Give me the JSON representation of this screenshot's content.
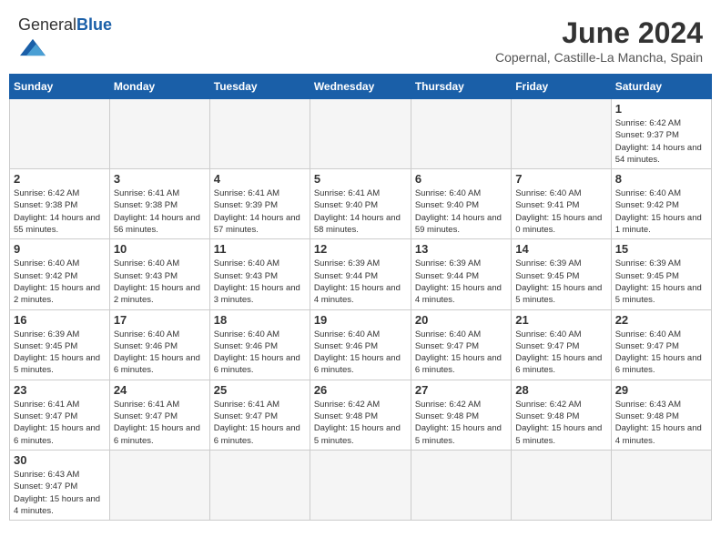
{
  "header": {
    "logo_general": "General",
    "logo_blue": "Blue",
    "month_title": "June 2024",
    "location": "Copernal, Castille-La Mancha, Spain"
  },
  "days_of_week": [
    "Sunday",
    "Monday",
    "Tuesday",
    "Wednesday",
    "Thursday",
    "Friday",
    "Saturday"
  ],
  "weeks": [
    [
      {
        "num": "",
        "info": "",
        "empty": true
      },
      {
        "num": "",
        "info": "",
        "empty": true
      },
      {
        "num": "",
        "info": "",
        "empty": true
      },
      {
        "num": "",
        "info": "",
        "empty": true
      },
      {
        "num": "",
        "info": "",
        "empty": true
      },
      {
        "num": "",
        "info": "",
        "empty": true
      },
      {
        "num": "1",
        "info": "Sunrise: 6:42 AM\nSunset: 9:37 PM\nDaylight: 14 hours\nand 54 minutes.",
        "empty": false
      }
    ],
    [
      {
        "num": "2",
        "info": "Sunrise: 6:42 AM\nSunset: 9:38 PM\nDaylight: 14 hours\nand 55 minutes.",
        "empty": false
      },
      {
        "num": "3",
        "info": "Sunrise: 6:41 AM\nSunset: 9:38 PM\nDaylight: 14 hours\nand 56 minutes.",
        "empty": false
      },
      {
        "num": "4",
        "info": "Sunrise: 6:41 AM\nSunset: 9:39 PM\nDaylight: 14 hours\nand 57 minutes.",
        "empty": false
      },
      {
        "num": "5",
        "info": "Sunrise: 6:41 AM\nSunset: 9:40 PM\nDaylight: 14 hours\nand 58 minutes.",
        "empty": false
      },
      {
        "num": "6",
        "info": "Sunrise: 6:40 AM\nSunset: 9:40 PM\nDaylight: 14 hours\nand 59 minutes.",
        "empty": false
      },
      {
        "num": "7",
        "info": "Sunrise: 6:40 AM\nSunset: 9:41 PM\nDaylight: 15 hours\nand 0 minutes.",
        "empty": false
      },
      {
        "num": "8",
        "info": "Sunrise: 6:40 AM\nSunset: 9:42 PM\nDaylight: 15 hours\nand 1 minute.",
        "empty": false
      }
    ],
    [
      {
        "num": "9",
        "info": "Sunrise: 6:40 AM\nSunset: 9:42 PM\nDaylight: 15 hours\nand 2 minutes.",
        "empty": false
      },
      {
        "num": "10",
        "info": "Sunrise: 6:40 AM\nSunset: 9:43 PM\nDaylight: 15 hours\nand 2 minutes.",
        "empty": false
      },
      {
        "num": "11",
        "info": "Sunrise: 6:40 AM\nSunset: 9:43 PM\nDaylight: 15 hours\nand 3 minutes.",
        "empty": false
      },
      {
        "num": "12",
        "info": "Sunrise: 6:39 AM\nSunset: 9:44 PM\nDaylight: 15 hours\nand 4 minutes.",
        "empty": false
      },
      {
        "num": "13",
        "info": "Sunrise: 6:39 AM\nSunset: 9:44 PM\nDaylight: 15 hours\nand 4 minutes.",
        "empty": false
      },
      {
        "num": "14",
        "info": "Sunrise: 6:39 AM\nSunset: 9:45 PM\nDaylight: 15 hours\nand 5 minutes.",
        "empty": false
      },
      {
        "num": "15",
        "info": "Sunrise: 6:39 AM\nSunset: 9:45 PM\nDaylight: 15 hours\nand 5 minutes.",
        "empty": false
      }
    ],
    [
      {
        "num": "16",
        "info": "Sunrise: 6:39 AM\nSunset: 9:45 PM\nDaylight: 15 hours\nand 5 minutes.",
        "empty": false
      },
      {
        "num": "17",
        "info": "Sunrise: 6:40 AM\nSunset: 9:46 PM\nDaylight: 15 hours\nand 6 minutes.",
        "empty": false
      },
      {
        "num": "18",
        "info": "Sunrise: 6:40 AM\nSunset: 9:46 PM\nDaylight: 15 hours\nand 6 minutes.",
        "empty": false
      },
      {
        "num": "19",
        "info": "Sunrise: 6:40 AM\nSunset: 9:46 PM\nDaylight: 15 hours\nand 6 minutes.",
        "empty": false
      },
      {
        "num": "20",
        "info": "Sunrise: 6:40 AM\nSunset: 9:47 PM\nDaylight: 15 hours\nand 6 minutes.",
        "empty": false
      },
      {
        "num": "21",
        "info": "Sunrise: 6:40 AM\nSunset: 9:47 PM\nDaylight: 15 hours\nand 6 minutes.",
        "empty": false
      },
      {
        "num": "22",
        "info": "Sunrise: 6:40 AM\nSunset: 9:47 PM\nDaylight: 15 hours\nand 6 minutes.",
        "empty": false
      }
    ],
    [
      {
        "num": "23",
        "info": "Sunrise: 6:41 AM\nSunset: 9:47 PM\nDaylight: 15 hours\nand 6 minutes.",
        "empty": false
      },
      {
        "num": "24",
        "info": "Sunrise: 6:41 AM\nSunset: 9:47 PM\nDaylight: 15 hours\nand 6 minutes.",
        "empty": false
      },
      {
        "num": "25",
        "info": "Sunrise: 6:41 AM\nSunset: 9:47 PM\nDaylight: 15 hours\nand 6 minutes.",
        "empty": false
      },
      {
        "num": "26",
        "info": "Sunrise: 6:42 AM\nSunset: 9:48 PM\nDaylight: 15 hours\nand 5 minutes.",
        "empty": false
      },
      {
        "num": "27",
        "info": "Sunrise: 6:42 AM\nSunset: 9:48 PM\nDaylight: 15 hours\nand 5 minutes.",
        "empty": false
      },
      {
        "num": "28",
        "info": "Sunrise: 6:42 AM\nSunset: 9:48 PM\nDaylight: 15 hours\nand 5 minutes.",
        "empty": false
      },
      {
        "num": "29",
        "info": "Sunrise: 6:43 AM\nSunset: 9:48 PM\nDaylight: 15 hours\nand 4 minutes.",
        "empty": false
      }
    ],
    [
      {
        "num": "30",
        "info": "Sunrise: 6:43 AM\nSunset: 9:47 PM\nDaylight: 15 hours\nand 4 minutes.",
        "empty": false
      },
      {
        "num": "",
        "info": "",
        "empty": true
      },
      {
        "num": "",
        "info": "",
        "empty": true
      },
      {
        "num": "",
        "info": "",
        "empty": true
      },
      {
        "num": "",
        "info": "",
        "empty": true
      },
      {
        "num": "",
        "info": "",
        "empty": true
      },
      {
        "num": "",
        "info": "",
        "empty": true
      }
    ]
  ]
}
